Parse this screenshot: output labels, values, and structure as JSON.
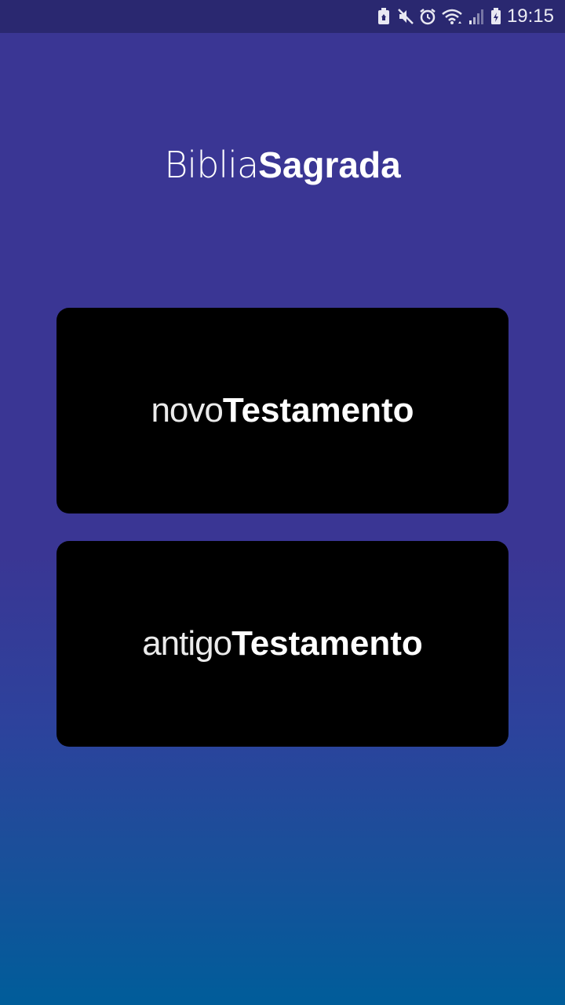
{
  "status_bar": {
    "time": "19:15",
    "icons": [
      "storage-icon",
      "mute-icon",
      "alarm-icon",
      "wifi-icon",
      "signal-icon",
      "battery-icon"
    ]
  },
  "header": {
    "title_light": "Biblia",
    "title_bold": "Sagrada"
  },
  "buttons": {
    "novo": {
      "light": "novo",
      "bold": "Testamento"
    },
    "antigo": {
      "light": "antigo",
      "bold": "Testamento"
    }
  },
  "colors": {
    "background_top": "#3a3694",
    "background_bottom": "#005d9a",
    "status_bar": "#2a2870",
    "card": "#000000",
    "text": "#ffffff"
  }
}
